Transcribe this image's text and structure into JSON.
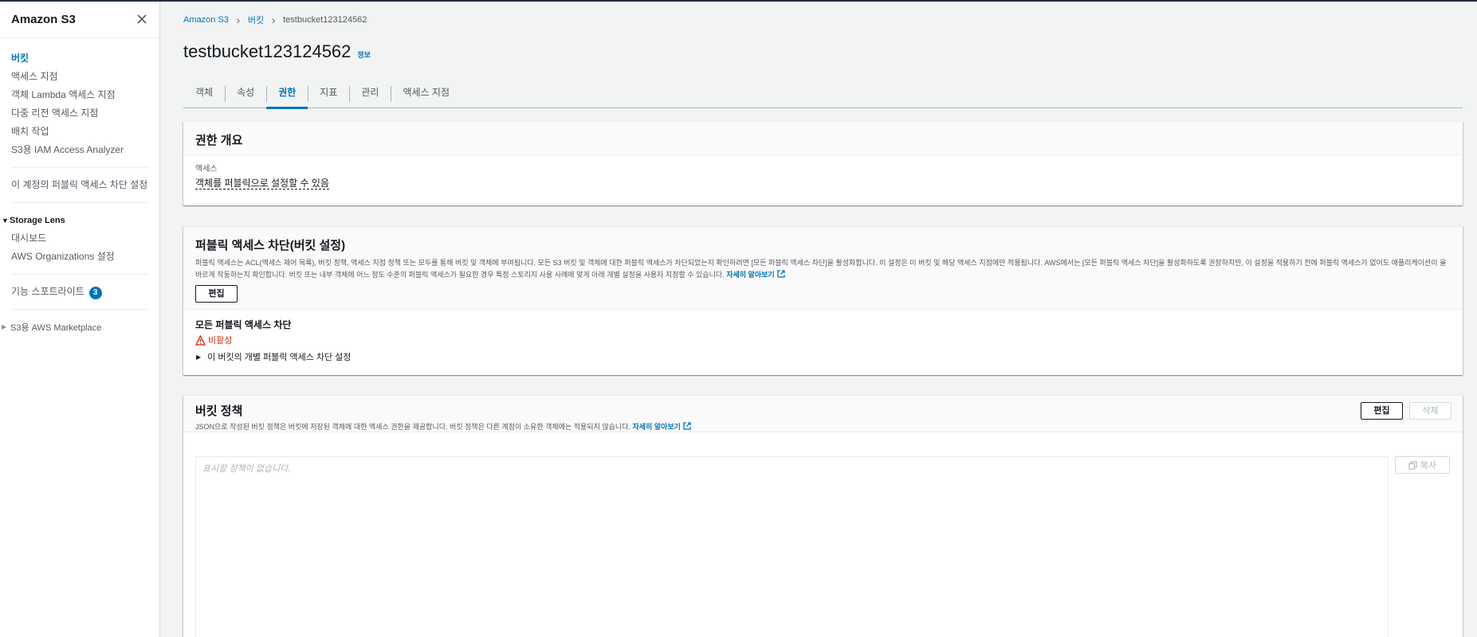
{
  "sidebar": {
    "title": "Amazon S3",
    "items": [
      "버킷",
      "액세스 지점",
      "객체 Lambda 액세스 지점",
      "다중 리전 액세스 지점",
      "배치 작업",
      "S3용 IAM Access Analyzer"
    ],
    "block_public_setting": "이 계정의 퍼블릭 액세스 차단 설정",
    "storage_lens": {
      "title": "Storage Lens",
      "items": [
        "대시보드",
        "AWS Organizations 설정"
      ]
    },
    "feature_spotlight": {
      "label": "기능 스포트라이트",
      "badge": "3"
    },
    "marketplace": "S3용 AWS Marketplace"
  },
  "breadcrumb": {
    "home": "Amazon S3",
    "buckets": "버킷",
    "current": "testbucket123124562"
  },
  "page": {
    "title": "testbucket123124562",
    "info": "정보"
  },
  "tabs": [
    "객체",
    "속성",
    "권한",
    "지표",
    "관리",
    "액세스 지점"
  ],
  "active_tab": "권한",
  "permissions_overview": {
    "title": "권한 개요",
    "access_label": "액세스",
    "access_value": "객체를 퍼블릭으로 설정할 수 있음"
  },
  "block_public_access": {
    "title": "퍼블릭 액세스 차단(버킷 설정)",
    "description": "퍼블릭 액세스는 ACL(액세스 제어 목록), 버킷 정책, 액세스 지점 정책 또는 모두를 통해 버킷 및 객체에 부여됩니다. 모든 S3 버킷 및 객체에 대한 퍼블릭 액세스가 차단되었는지 확인하려면 [모든 퍼블릭 액세스 차단]을 활성화합니다. 이 설정은 이 버킷 및 해당 액세스 지점에만 적용됩니다. AWS에서는 [모든 퍼블릭 액세스 차단]을 활성화하도록 권장하지만, 이 설정을 적용하기 전에 퍼블릭 액세스가 없어도 애플리케이션이 올바르게 작동하는지 확인합니다. 버킷 또는 내부 객체에 어느 정도 수준의 퍼블릭 액세스가 필요한 경우 특정 스토리지 사용 사례에 맞게 아래 개별 설정을 사용자 지정할 수 있습니다.",
    "learn_more": "자세히 알아보기",
    "edit_label": "편집",
    "block_all_label": "모든 퍼블릭 액세스 차단",
    "status": "비활성",
    "expander": "이 버킷의 개별 퍼블릭 액세스 차단 설정"
  },
  "bucket_policy": {
    "title": "버킷 정책",
    "description": "JSON으로 작성된 버킷 정책은 버킷에 저장된 객체에 대한 액세스 권한을 제공합니다. 버킷 정책은 다른 계정이 소유한 객체에는 적용되지 않습니다.",
    "learn_more": "자세히 알아보기",
    "edit_label": "편집",
    "delete_label": "삭제",
    "placeholder": "표시할 정책이 없습니다.",
    "copy_label": "복사"
  },
  "colors": {
    "link": "#0073bb",
    "error": "#d13212",
    "topbar": "#232f3e"
  }
}
